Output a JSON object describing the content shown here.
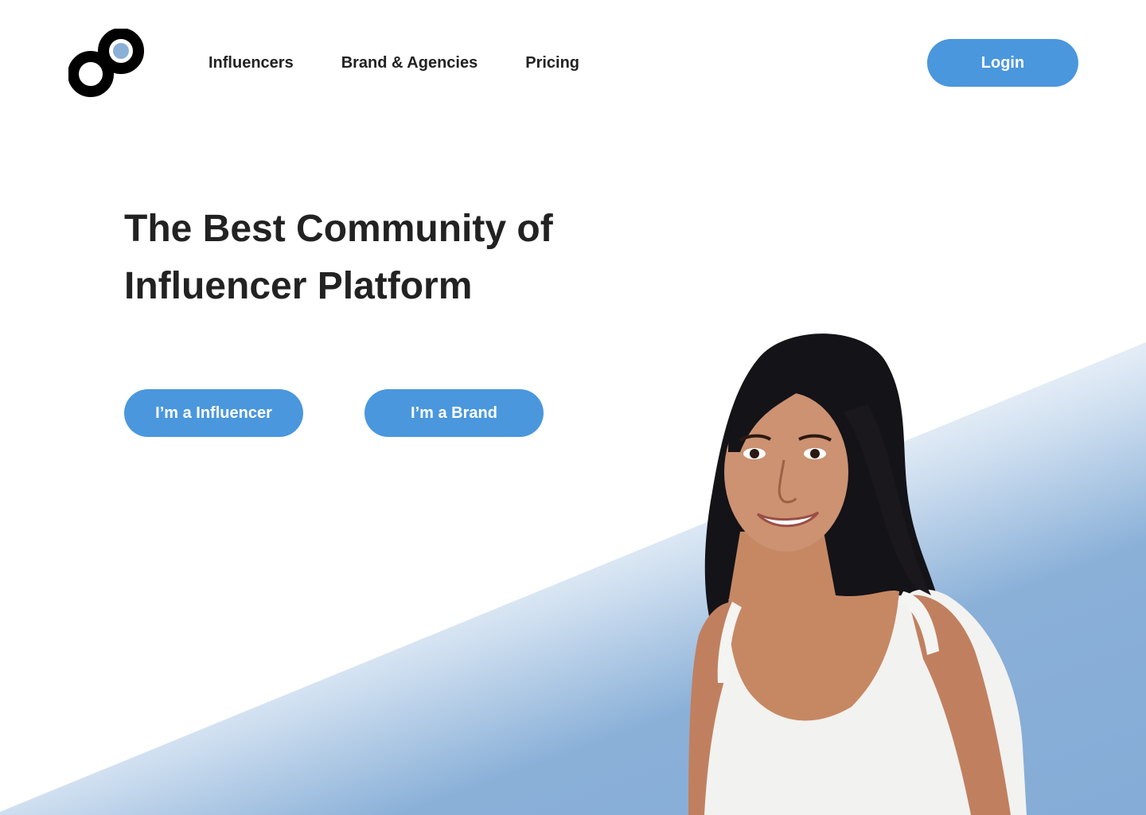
{
  "header": {
    "logo_icon": "brand-logo-icon",
    "nav": [
      {
        "label": "Influencers"
      },
      {
        "label": "Brand & Agencies"
      },
      {
        "label": "Pricing"
      }
    ],
    "login_label": "Login"
  },
  "hero": {
    "title_line1": "The Best Community of",
    "title_line2": "Influencer Platform",
    "cta_influencer": "I’m a Influencer",
    "cta_brand": "I’m a Brand"
  },
  "colors": {
    "accent": "#4a97dd",
    "gradient_light": "#cfdff0",
    "gradient_dark": "#84acd6",
    "text": "#222222"
  }
}
